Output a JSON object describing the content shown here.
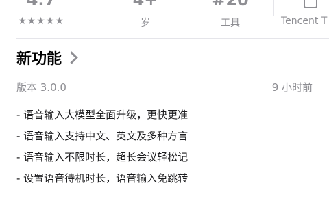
{
  "stats": [
    {
      "value": "4.7",
      "sub": "★★★★★"
    },
    {
      "value": "4+",
      "sub": "岁"
    },
    {
      "value": "#20",
      "sub": "工具"
    },
    {
      "value": "",
      "sub": "Tencent T",
      "icon": "developer-icon"
    }
  ],
  "whats_new": {
    "title": "新功能",
    "version": "版本 3.0.0",
    "time": "9 小时前",
    "notes": [
      "- 语音输入大模型全面升级，更快更准",
      "- 语音输入支持中文、英文及多种方言",
      "- 语音输入不限时长，超长会议轻松记",
      "- 设置语音待机时长，语音输入免跳转"
    ]
  }
}
